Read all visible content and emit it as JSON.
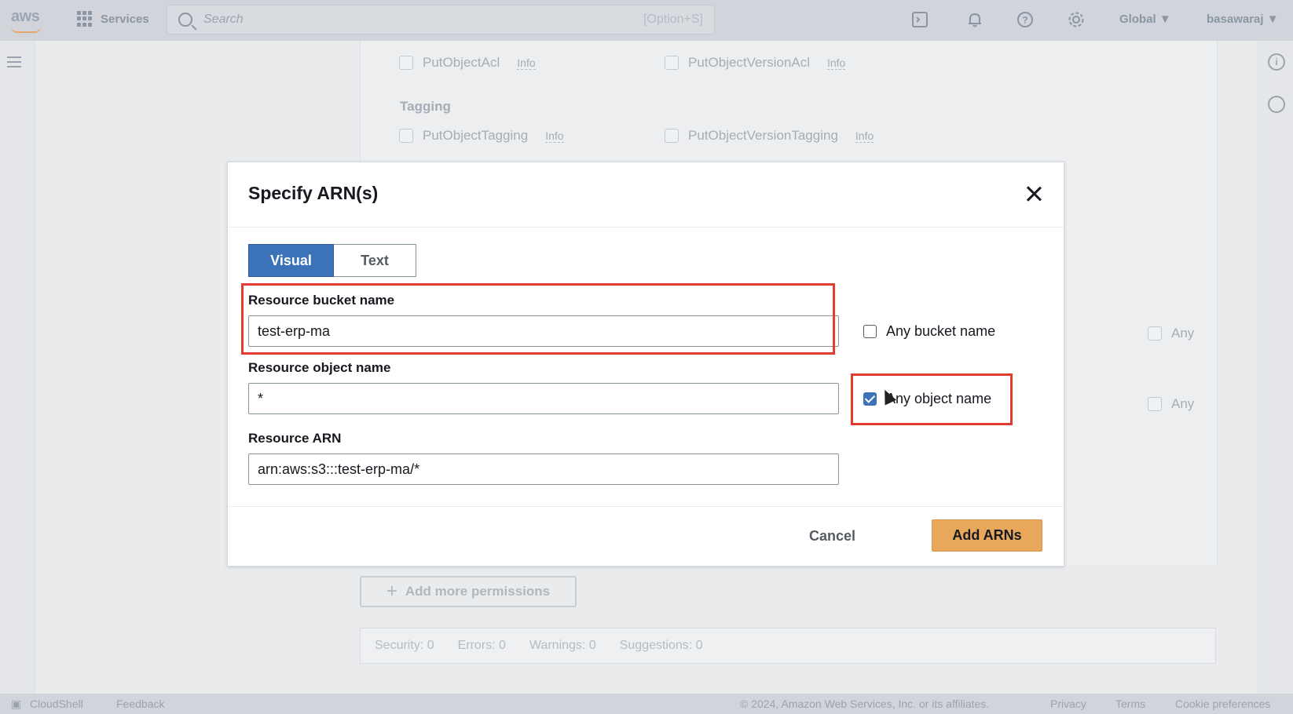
{
  "topnav": {
    "logo": "aws",
    "services_label": "Services",
    "search_placeholder": "Search",
    "search_shortcut": "[Option+S]",
    "region": "Global ▼",
    "user": "basawaraj ▼"
  },
  "background": {
    "perm_row1": [
      {
        "label": "PutObjectAcl",
        "info": "Info"
      },
      {
        "label": "PutObjectVersionAcl",
        "info": "Info"
      }
    ],
    "section_tagging": "Tagging",
    "perm_row2": [
      {
        "label": "PutObjectTagging",
        "info": "Info"
      },
      {
        "label": "PutObjectVersionTagging",
        "info": "Info"
      }
    ],
    "any_label_1": "Any",
    "any_label_2": "Any",
    "add_more_permissions": "Add more permissions",
    "status": {
      "security": "Security: 0",
      "errors": "Errors: 0",
      "warnings": "Warnings: 0",
      "suggestions": "Suggestions: 0"
    }
  },
  "modal": {
    "title": "Specify ARN(s)",
    "tabs": {
      "visual": "Visual",
      "text": "Text"
    },
    "bucket": {
      "label": "Resource bucket name",
      "value": "test-erp-ma",
      "any_label": "Any bucket name",
      "any_checked": false
    },
    "object": {
      "label": "Resource object name",
      "value": "*",
      "any_label": "Any object name",
      "any_checked": true
    },
    "arn": {
      "label": "Resource ARN",
      "value": "arn:aws:s3:::test-erp-ma/*"
    },
    "cancel_label": "Cancel",
    "add_label": "Add ARNs"
  },
  "footer": {
    "cloudshell": "CloudShell",
    "feedback": "Feedback",
    "copyright": "© 2024, Amazon Web Services, Inc. or its affiliates.",
    "privacy": "Privacy",
    "terms": "Terms",
    "cookies": "Cookie preferences"
  },
  "colors": {
    "primary": "#3b72b8",
    "accent_button": "#e8a75b",
    "highlight": "#e53a2f"
  }
}
